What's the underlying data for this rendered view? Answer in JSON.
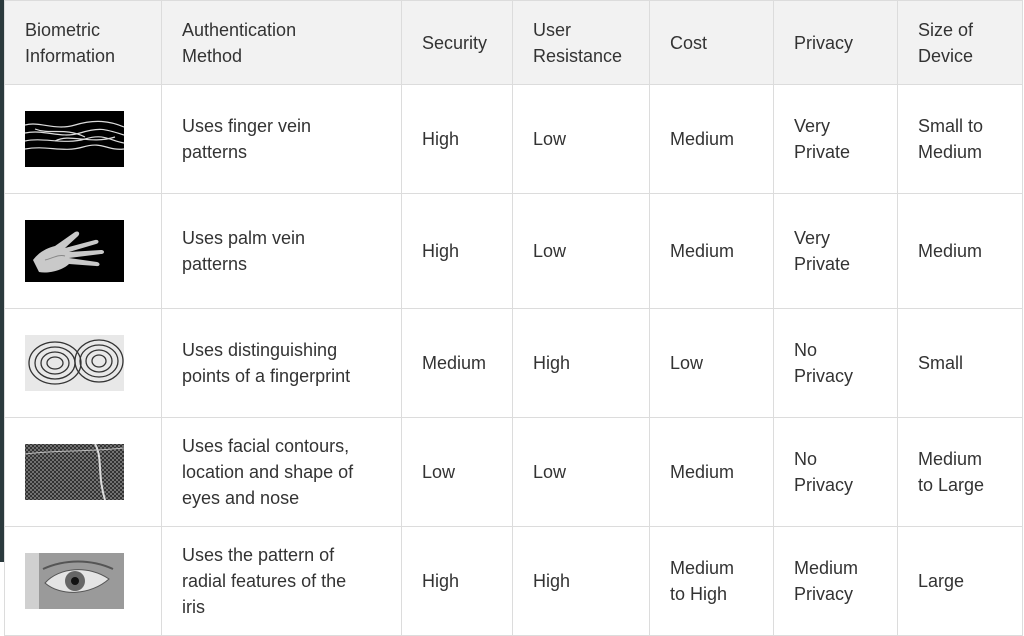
{
  "headers": [
    "Biometric\nInformation",
    "Authentication\nMethod",
    "Security",
    "User\nResistance",
    "Cost",
    "Privacy",
    "Size of\nDevice"
  ],
  "rows": [
    {
      "image": "finger-vein-image",
      "method": "Uses finger vein\npatterns",
      "security": "High",
      "resistance": "Low",
      "cost": "Medium",
      "privacy": "Very\nPrivate",
      "size": "Small to\nMedium"
    },
    {
      "image": "palm-vein-image",
      "method": "Uses palm vein\npatterns",
      "security": "High",
      "resistance": "Low",
      "cost": "Medium",
      "privacy": "Very\nPrivate",
      "size": "Medium"
    },
    {
      "image": "fingerprint-image",
      "method": "Uses distinguishing\npoints of a fingerprint",
      "security": "Medium",
      "resistance": "High",
      "cost": "Low",
      "privacy": "No\nPrivacy",
      "size": "Small"
    },
    {
      "image": "face-image",
      "method": "Uses facial contours,\nlocation and shape of\neyes and nose",
      "security": "Low",
      "resistance": "Low",
      "cost": "Medium",
      "privacy": "No\nPrivacy",
      "size": "Medium\nto Large"
    },
    {
      "image": "iris-image",
      "method": "Uses the pattern of\nradial features of the\niris",
      "security": "High",
      "resistance": "High",
      "cost": "Medium\nto High",
      "privacy": "Medium\nPrivacy",
      "size": "Large"
    }
  ]
}
